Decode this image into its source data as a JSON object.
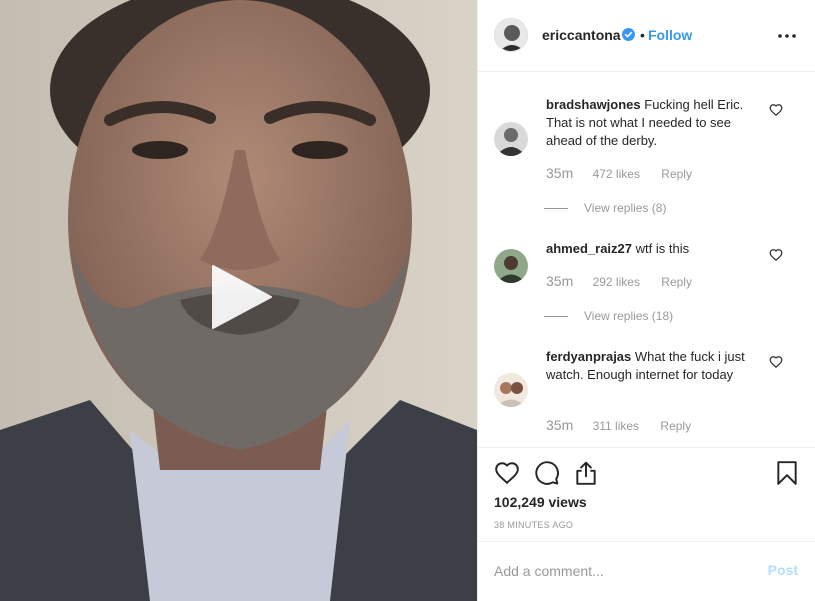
{
  "post": {
    "username": "ericcantona",
    "separator": "•",
    "follow_label": "Follow",
    "verified_icon": "verified-badge-icon",
    "more_icon": "more-options-icon"
  },
  "media": {
    "type": "video",
    "play_icon": "play-icon"
  },
  "comments": [
    {
      "username": "bradshawjones",
      "text": "Fucking hell Eric. That is not what I needed to see ahead of the derby.",
      "time": "35m",
      "likes": "472 likes",
      "reply_label": "Reply",
      "view_replies": "View replies (8)"
    },
    {
      "username": "ahmed_raiz27",
      "text": "wtf is this",
      "time": "35m",
      "likes": "292 likes",
      "reply_label": "Reply",
      "view_replies": "View replies (18)"
    },
    {
      "username": "ferdyanprajas",
      "text": "What the fuck i just watch. Enough internet for today",
      "time": "35m",
      "likes": "311 likes",
      "reply_label": "Reply"
    }
  ],
  "actions": {
    "like_icon": "heart-icon",
    "comment_icon": "comment-icon",
    "share_icon": "share-icon",
    "save_icon": "bookmark-icon"
  },
  "stats": {
    "views": "102,249 views",
    "time_ago": "38 MINUTES AGO"
  },
  "add_comment": {
    "placeholder": "Add a comment...",
    "post_label": "Post"
  },
  "colors": {
    "link": "#3897f0",
    "muted": "#999999",
    "post_disabled": "#b2dffc",
    "verified": "#3897f0"
  }
}
